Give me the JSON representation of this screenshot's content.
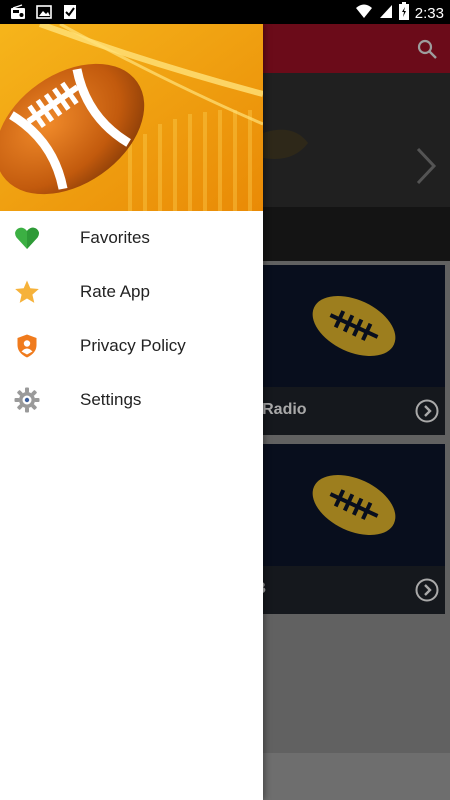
{
  "status_bar": {
    "time": "2:33",
    "left_icons": [
      "radio-icon",
      "image-icon",
      "checklist-icon"
    ],
    "right_icons": [
      "wifi-icon",
      "signal-icon",
      "battery-icon"
    ]
  },
  "drawer": {
    "items": [
      {
        "label": "Favorites",
        "icon": "heart-icon",
        "color": "#3cb043"
      },
      {
        "label": "Rate App",
        "icon": "star-icon",
        "color": "#f6b23a"
      },
      {
        "label": "Privacy Policy",
        "icon": "shield-icon",
        "color": "#f07b1d"
      },
      {
        "label": "Settings",
        "icon": "gear-icon",
        "color": "#8a8a8a"
      }
    ]
  },
  "stations": [
    {
      "title": "N Sports Radio"
    },
    {
      "title": "UB"
    }
  ],
  "colors": {
    "toolbar": "#8a0f20",
    "header": "#f3a514",
    "card": "#0b1326",
    "football": "#c9a227"
  }
}
